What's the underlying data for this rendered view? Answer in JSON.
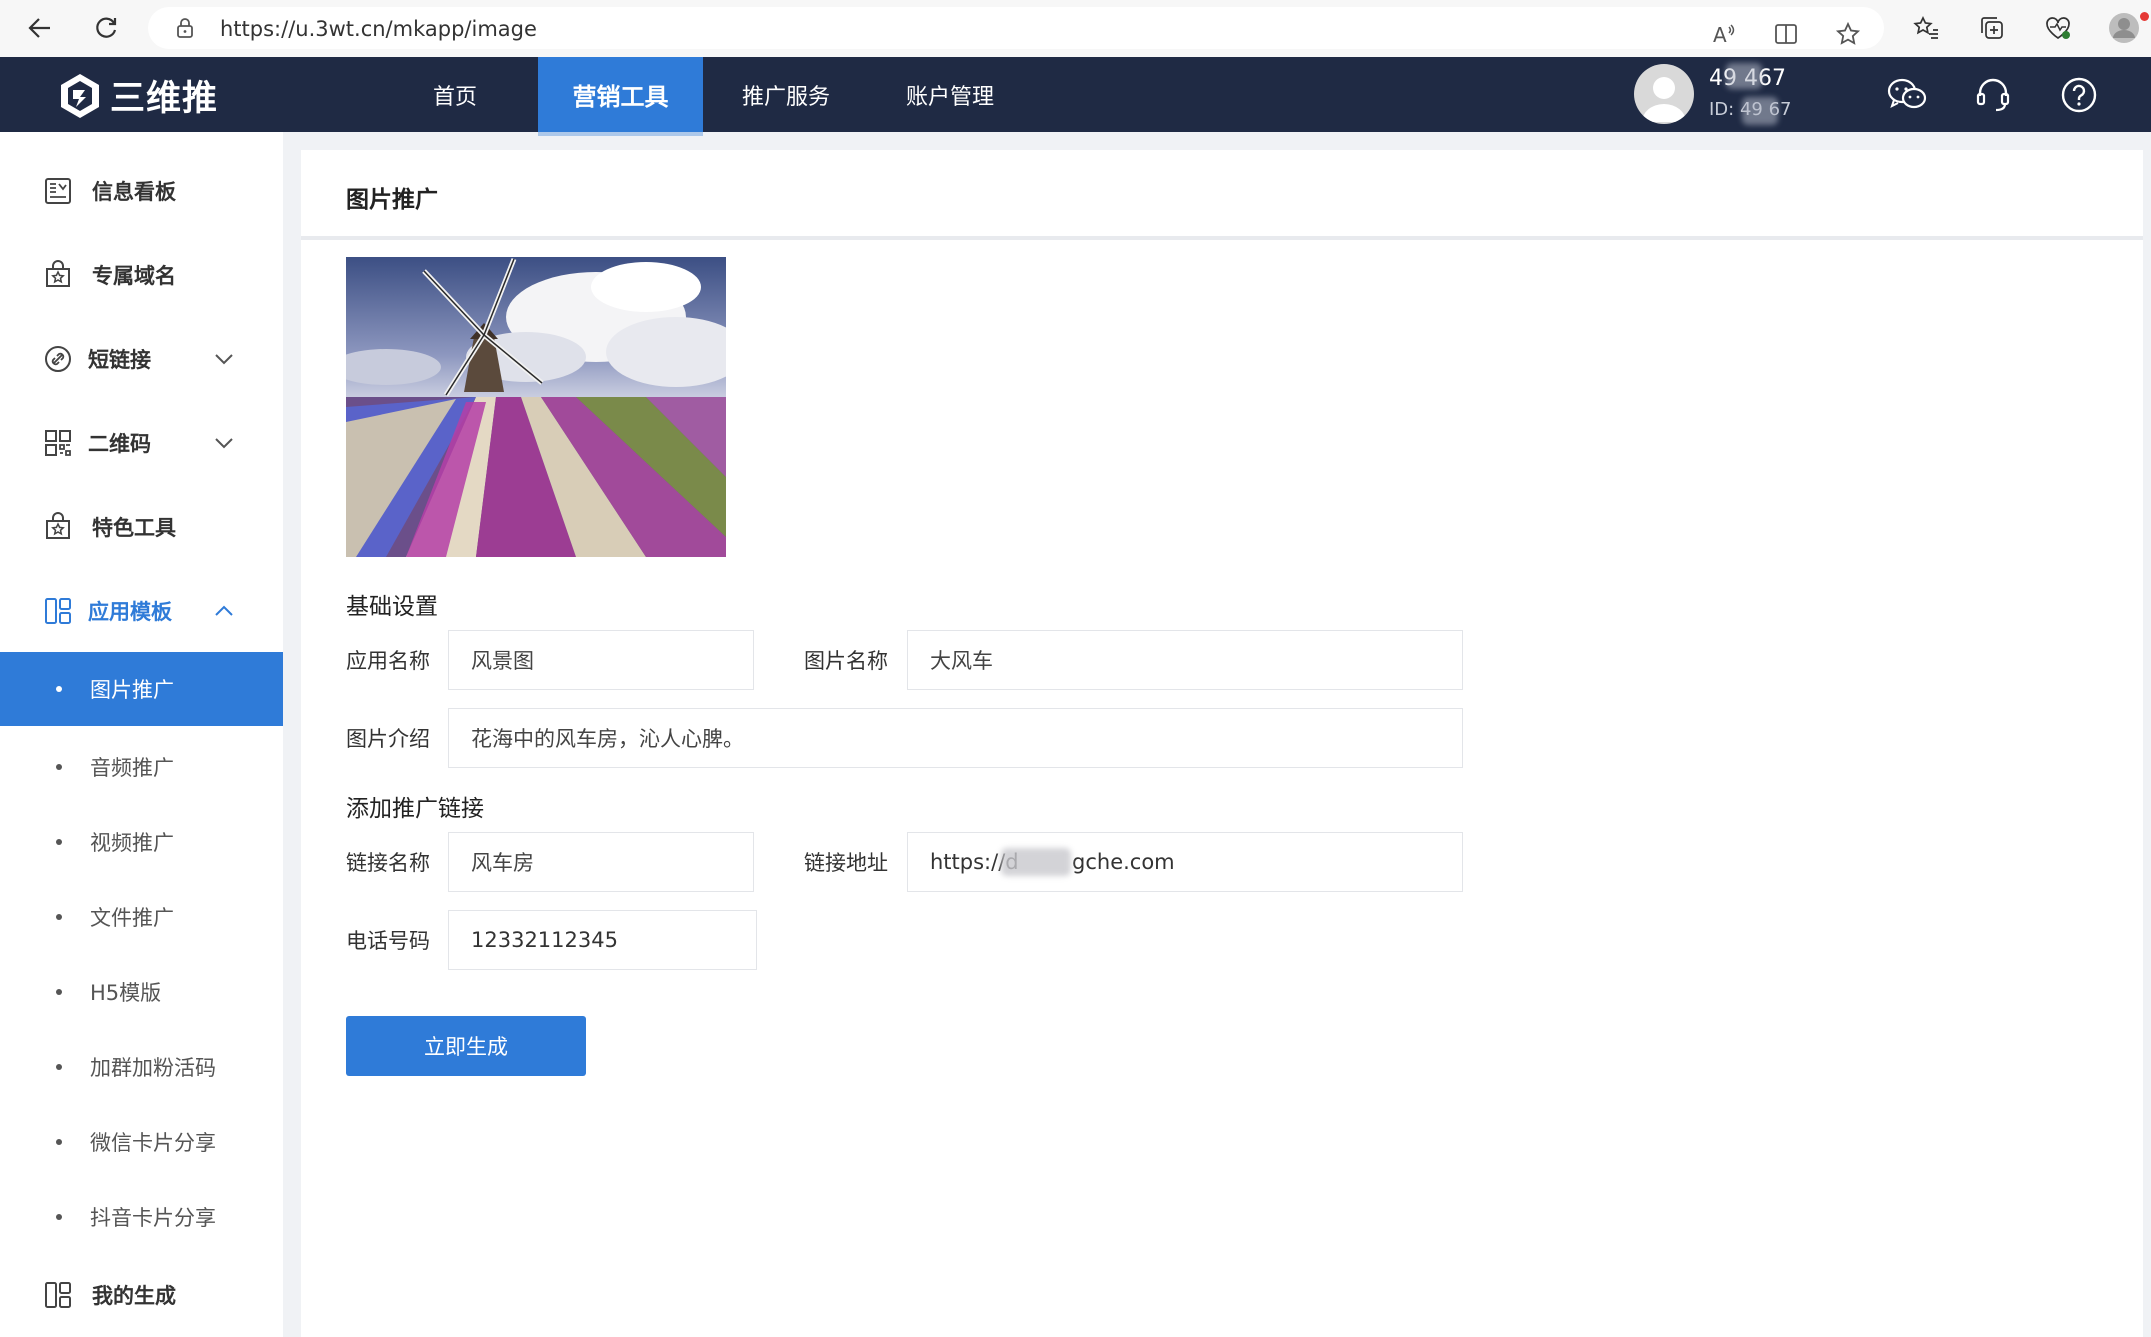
{
  "browser": {
    "url": "https://u.3wt.cn/mkapp/image"
  },
  "app": {
    "logo_text": "三维推",
    "nav": [
      {
        "label": "首页"
      },
      {
        "label": "营销工具"
      },
      {
        "label": "推广服务"
      },
      {
        "label": "账户管理"
      }
    ],
    "user": {
      "name": "49   467",
      "id": "ID: 49   67"
    }
  },
  "sidebar": {
    "items": [
      {
        "label": "信息看板",
        "icon": "dashboard-icon"
      },
      {
        "label": "专属域名",
        "icon": "shop-badge-icon"
      },
      {
        "label": "短链接",
        "icon": "link-clip-icon"
      },
      {
        "label": "二维码",
        "icon": "qrcode-icon"
      },
      {
        "label": "特色工具",
        "icon": "shop-badge-icon"
      },
      {
        "label": "应用模板",
        "icon": "template-icon"
      }
    ],
    "sub_items": [
      {
        "label": "图片推广"
      },
      {
        "label": "音频推广"
      },
      {
        "label": "视频推广"
      },
      {
        "label": "文件推广"
      },
      {
        "label": "H5模版"
      },
      {
        "label": "加群加粉活码"
      },
      {
        "label": "微信卡片分享"
      },
      {
        "label": "抖音卡片分享"
      }
    ],
    "last_item": {
      "label": "我的生成",
      "icon": "template-icon"
    }
  },
  "main": {
    "title": "图片推广",
    "basic_section": "基础设置",
    "app_name_label": "应用名称",
    "app_name_value": "风景图",
    "image_name_label": "图片名称",
    "image_name_value": "大风车",
    "image_desc_label": "图片介绍",
    "image_desc_value": "花海中的风车房，沁人心脾。",
    "link_section": "添加推广链接",
    "link_name_label": "链接名称",
    "link_name_value": "风车房",
    "link_url_label": "链接地址",
    "link_url_value": "https://d        gche.com",
    "phone_label": "电话号码",
    "phone_value": "12332112345",
    "generate_label": "立即生成"
  },
  "colors": {
    "accent": "#2f7bd8",
    "topbar": "#1f2a44"
  }
}
